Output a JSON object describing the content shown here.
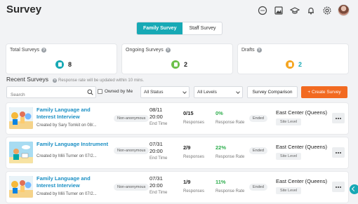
{
  "page": {
    "title": "Survey"
  },
  "top_icons": [
    "chat-icon",
    "image-icon",
    "graduation-icon",
    "bell-icon",
    "gear-icon",
    "avatar"
  ],
  "tabs": [
    {
      "label": "Family Survey",
      "active": true
    },
    {
      "label": "Staff Survey",
      "active": false
    }
  ],
  "stats": [
    {
      "label": "Total Surveys",
      "value": "8",
      "color": "#17a9b5"
    },
    {
      "label": "Ongoing Surveys",
      "value": "2",
      "color": "#6cc04a"
    },
    {
      "label": "Drafts",
      "value": "2",
      "color": "#f5a623"
    }
  ],
  "recent": {
    "heading": "Recent Surveys",
    "note": "Response rate will be updated within 10 mins."
  },
  "filters": {
    "search_placeholder": "Search",
    "owned_label": "Owned by Me",
    "status_value": "All Status",
    "levels_value": "All Levels",
    "comparison_label": "Survey Comparison",
    "create_label": "+ Create Survey",
    "create_color": "#f26a21"
  },
  "rows": [
    {
      "name": "Family Language and Interest Interview",
      "creator": "Created by Sary Tomkit on 08/...",
      "privacy": "Non-anonymous",
      "date": "08/11",
      "time": "20:00",
      "date_label": "End Time",
      "responses": "0/15",
      "responses_label": "Responses",
      "rate": "0%",
      "rate_label": "Response Rate",
      "status": "Ended",
      "center": "East Center (Queens)",
      "level": "Site Level"
    },
    {
      "name": "Family Language Instrument",
      "creator": "Created by Mili Turner on 07/2...",
      "privacy": "Non-anonymous",
      "date": "07/31",
      "time": "20:00",
      "date_label": "End Time",
      "responses": "2/9",
      "responses_label": "Responses",
      "rate": "22%",
      "rate_label": "Response Rate",
      "status": "Ended",
      "center": "East Center (Queens)",
      "level": "Site Level"
    },
    {
      "name": "Family Language and Interest Interview",
      "creator": "Created by Mili Turner on 07/2...",
      "privacy": "Non-anonymous",
      "date": "07/31",
      "time": "20:00",
      "date_label": "End Time",
      "responses": "1/9",
      "responses_label": "Responses",
      "rate": "11%",
      "rate_label": "Response Rate",
      "status": "Ended",
      "center": "East Center (Queens)",
      "level": "Site Level"
    }
  ]
}
